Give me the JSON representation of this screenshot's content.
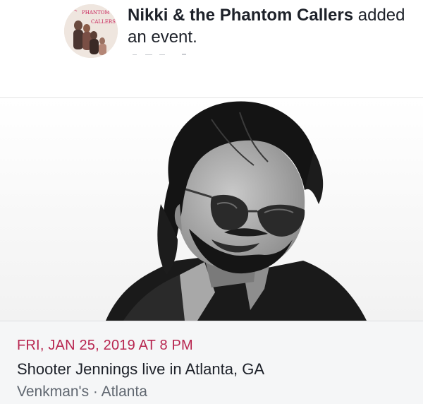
{
  "post": {
    "page_name": "Nikki & the Phantom Callers",
    "action_text": " added an event."
  },
  "avatar": {
    "logo_text_top": "PHANTOM",
    "logo_text_bottom": "CALLERS"
  },
  "event": {
    "date": "FRI, JAN 25, 2019 AT 8 PM",
    "title": "Shooter Jennings live in Atlanta, GA",
    "location": "Venkman's · Atlanta"
  },
  "colors": {
    "date_accent": "#b82650",
    "title_text": "#1d2129",
    "secondary_text": "#606770",
    "info_background": "#f5f6f7"
  },
  "icons": {
    "avatar": "band-profile-photo",
    "cover": "event-cover-photo-bw-portrait"
  }
}
